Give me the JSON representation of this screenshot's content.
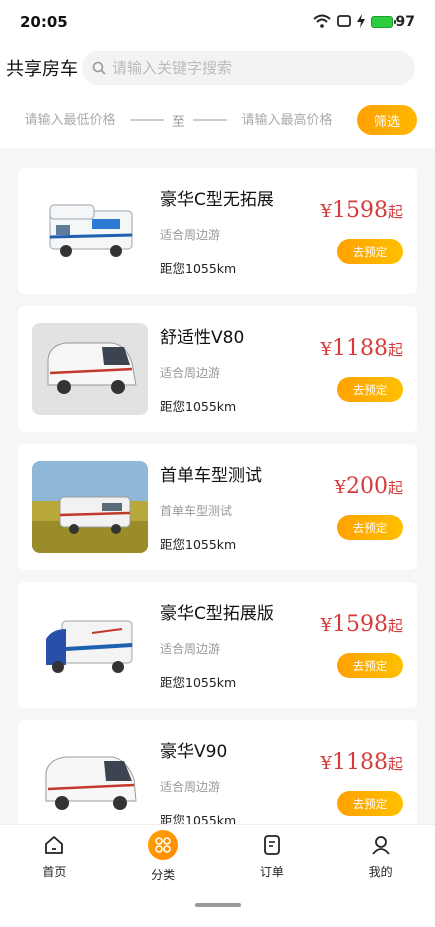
{
  "status_bar": {
    "time": "20:05",
    "battery": "97"
  },
  "header": {
    "title": "共享房车",
    "search_placeholder": "请输入关键字搜索"
  },
  "filter": {
    "min_placeholder": "请输入最低价格",
    "to_label": "至",
    "max_placeholder": "请输入最高价格",
    "button_label": "筛选"
  },
  "cars": [
    {
      "name": "豪华C型无拓展",
      "tag": "适合周边游",
      "distance": "距您1055km",
      "currency": "¥",
      "price": "1598",
      "suffix": "起",
      "button": "去预定"
    },
    {
      "name": "舒适性V80",
      "tag": "适合周边游",
      "distance": "距您1055km",
      "currency": "¥",
      "price": "1188",
      "suffix": "起",
      "button": "去预定"
    },
    {
      "name": "首单车型测试",
      "tag": "首单车型测试",
      "distance": "距您1055km",
      "currency": "¥",
      "price": "200",
      "suffix": "起",
      "button": "去预定"
    },
    {
      "name": "豪华C型拓展版",
      "tag": "适合周边游",
      "distance": "距您1055km",
      "currency": "¥",
      "price": "1598",
      "suffix": "起",
      "button": "去预定"
    },
    {
      "name": "豪华V90",
      "tag": "适合周边游",
      "distance": "距您1055km",
      "currency": "¥",
      "price": "1188",
      "suffix": "起",
      "button": "去预定"
    }
  ],
  "tabbar": {
    "items": [
      {
        "label": "首页",
        "icon": "home-icon"
      },
      {
        "label": "分类",
        "icon": "category-icon",
        "active": true
      },
      {
        "label": "订单",
        "icon": "order-icon"
      },
      {
        "label": "我的",
        "icon": "profile-icon"
      }
    ]
  },
  "colors": {
    "accent": "#ffa100",
    "price": "#d63a3a"
  }
}
